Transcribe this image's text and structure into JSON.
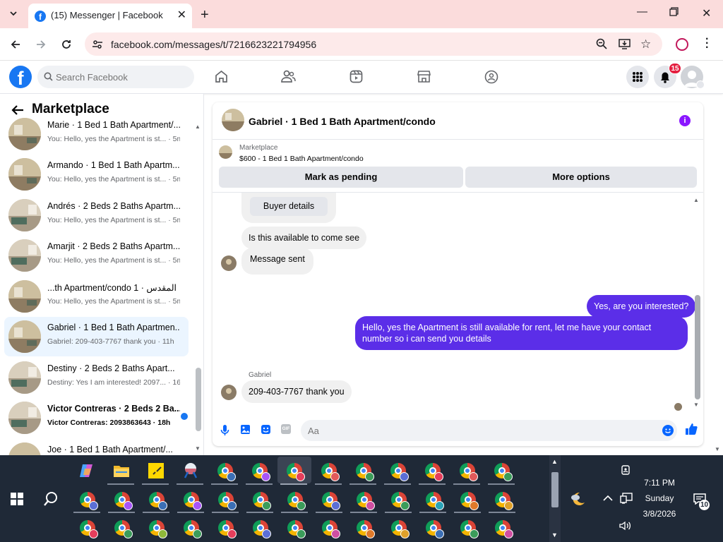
{
  "browser": {
    "tab_title": "(15) Messenger | Facebook",
    "url": "facebook.com/messages/t/7216623221794956"
  },
  "fb": {
    "search_placeholder": "Search Facebook",
    "notif_count": "15"
  },
  "sidebar": {
    "title": "Marketplace",
    "conversations": [
      {
        "name": "Marie · 1 Bed 1 Bath Apartment/...",
        "snippet": "You: Hello, yes the Apartment is st... · 5m"
      },
      {
        "name": "Armando · 1 Bed 1 Bath Apartm...",
        "snippet": "You: Hello, yes the Apartment is st... · 5m"
      },
      {
        "name": "Andrés · 2 Beds 2 Baths Apartm...",
        "snippet": "You: Hello, yes the Apartment is st... · 5m"
      },
      {
        "name": "Amarjit · 2 Beds 2 Baths Apartm...",
        "snippet": "You: Hello, yes the Apartment is st... · 5m"
      },
      {
        "name": "...th Apartment/condo 1 · المقدس",
        "snippet": "You: Hello, yes the Apartment is st... · 5m"
      },
      {
        "name": "Gabriel · 1 Bed 1 Bath Apartmen...",
        "snippet": "Gabriel: 209-403-7767 thank you · 11h"
      },
      {
        "name": "Destiny · 2 Beds 2 Baths Apart...",
        "snippet": "Destiny: Yes I am interested! 2097... · 16h"
      },
      {
        "name": "Victor Contreras · 2 Beds 2 Ba...",
        "snippet": "Victor Contreras: 2093863643 · 18h"
      },
      {
        "name": "Joe · 1 Bed 1 Bath Apartment/...",
        "snippet": ""
      }
    ]
  },
  "chat": {
    "title": "Gabriel · 1 Bed 1 Bath Apartment/condo",
    "listing_source": "Marketplace",
    "listing_line": "$600 - 1 Bed 1 Bath Apartment/condo",
    "mark_pending": "Mark as pending",
    "more_options": "More options",
    "buyer_details": "Buyer details",
    "messages": [
      "Is this available to come see",
      "Message sent",
      "Yes, are you interested?",
      "Hello, yes the Apartment is still available for rent, let me have your contact number so i can send you details",
      "Gabriel",
      "209-403-7767 thank you"
    ],
    "composer_placeholder": "Aa"
  },
  "taskbar": {
    "time": "7:11 PM",
    "day": "Sunday",
    "date": "3/8/2026",
    "notif_count": "10"
  }
}
